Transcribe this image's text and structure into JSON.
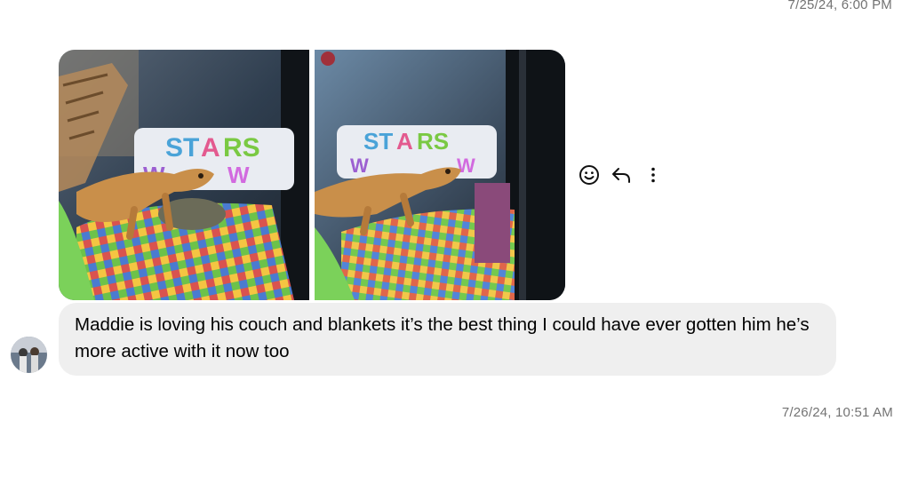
{
  "thread": {
    "timestamp_top": "7/25/24, 6:00 PM",
    "timestamp_bottom": "7/26/24, 10:51 AM"
  },
  "message": {
    "text": "Maddie is loving his couch and blankets it’s the best thing I could have ever gotten him he’s more active with it now too",
    "bubble_color": "#efefef"
  },
  "photos": [
    {
      "name": "photo-1"
    },
    {
      "name": "photo-2"
    }
  ],
  "actions": [
    {
      "icon": "emoji-react-icon"
    },
    {
      "icon": "reply-icon"
    },
    {
      "icon": "more-options-icon"
    }
  ]
}
